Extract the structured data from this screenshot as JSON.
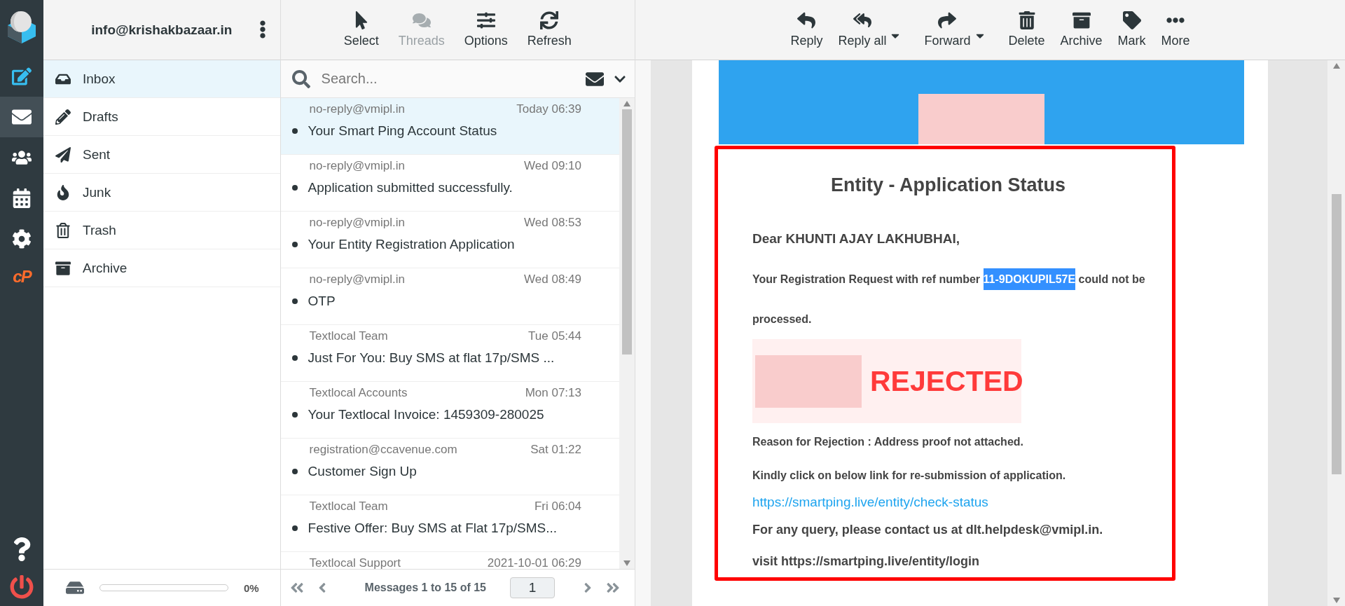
{
  "nav": {
    "logo_text": "cP",
    "items": [
      {
        "selected": false
      },
      {
        "selected": true
      },
      {
        "selected": false
      },
      {
        "selected": false
      },
      {
        "selected": false
      }
    ]
  },
  "account": {
    "email": "info@krishakbazaar.in"
  },
  "folders": [
    {
      "label": "Inbox",
      "selected": true
    },
    {
      "label": "Drafts",
      "selected": false
    },
    {
      "label": "Sent",
      "selected": false
    },
    {
      "label": "Junk",
      "selected": false
    },
    {
      "label": "Trash",
      "selected": false
    },
    {
      "label": "Archive",
      "selected": false
    }
  ],
  "quota": {
    "level": 0,
    "reading": "0%"
  },
  "list_toolbar": [
    {
      "label": "Select",
      "disabled": false
    },
    {
      "label": "Threads",
      "disabled": true
    },
    {
      "label": "Options",
      "disabled": false
    },
    {
      "label": "Refresh",
      "disabled": false
    }
  ],
  "search": {
    "placeholder": "Search..."
  },
  "messages": [
    {
      "sender": "no-reply@vmipl.in",
      "date": "Today 06:39",
      "subject": "Your Smart Ping Account Status",
      "unread": true,
      "selected": true
    },
    {
      "sender": "no-reply@vmipl.in",
      "date": "Wed 09:10",
      "subject": "Application submitted successfully.",
      "unread": true,
      "selected": false
    },
    {
      "sender": "no-reply@vmipl.in",
      "date": "Wed 08:53",
      "subject": "Your Entity Registration Application",
      "unread": true,
      "selected": false
    },
    {
      "sender": "no-reply@vmipl.in",
      "date": "Wed 08:49",
      "subject": "OTP",
      "unread": true,
      "selected": false
    },
    {
      "sender": "Textlocal Team",
      "date": "Tue 05:44",
      "subject": "Just For You: Buy SMS at flat 17p/SMS ...",
      "unread": true,
      "selected": false
    },
    {
      "sender": "Textlocal Accounts",
      "date": "Mon 07:13",
      "subject": "Your Textlocal Invoice: 1459309-280025",
      "unread": true,
      "selected": false
    },
    {
      "sender": "registration@ccavenue.com",
      "date": "Sat 01:22",
      "subject": "Customer Sign Up",
      "unread": true,
      "selected": false
    },
    {
      "sender": "Textlocal Team",
      "date": "Fri 06:04",
      "subject": "Festive Offer: Buy SMS at Flat 17p/SMS...",
      "unread": true,
      "selected": false
    },
    {
      "sender": "Textlocal Support",
      "date": "2021-10-01 06:29",
      "selected": false
    }
  ],
  "pagination": {
    "summary": "Messages 1 to 15 of 15",
    "page": "1"
  },
  "message_toolbar": [
    {
      "label": "Reply",
      "has_menu": false
    },
    {
      "label": "Reply all",
      "has_menu": true
    },
    {
      "label": "Forward",
      "has_menu": true
    },
    {
      "label": "Delete",
      "has_menu": false
    },
    {
      "label": "Archive",
      "has_menu": false
    },
    {
      "label": "Mark",
      "has_menu": false
    },
    {
      "label": "More",
      "has_menu": false
    }
  ],
  "email": {
    "title": "Entity - Application Status",
    "greeting": "Dear KHUNTI AJAY LAKHUBHAI,",
    "request": {
      "before": "Your Registration Request with ref number ",
      "ref": "11-9DOKUPIL57E",
      "after": " could not be processed.",
      "ref_selected": true
    },
    "status": "REJECTED",
    "reason": "Reason for Rejection : Address proof not attached.",
    "instruction": "Kindly click on below link for re-submission of application.",
    "link": "https://smartping.live/entity/check-status",
    "contact": "For any query, please contact us at dlt.helpdesk@vmipl.in.",
    "visit": "visit https://smartping.live/entity/login"
  }
}
